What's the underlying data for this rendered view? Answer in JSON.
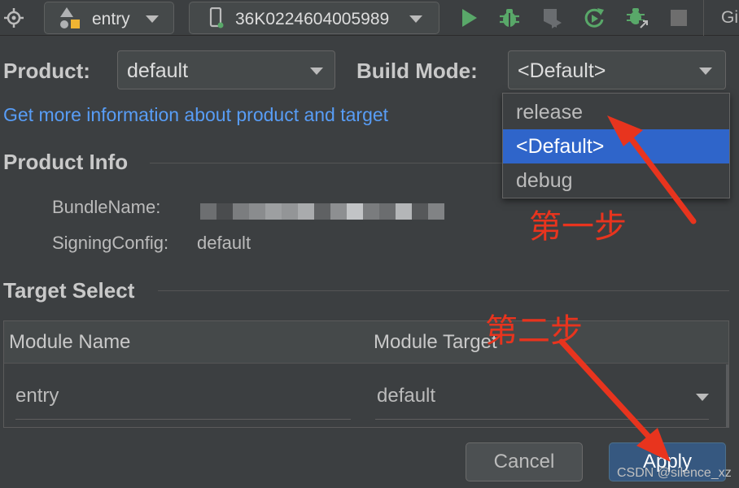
{
  "toolbar": {
    "module_combo": "entry",
    "device_combo": "36K0224604005989",
    "vcs_label": "Gi",
    "icons": [
      "target-icon",
      "module-shapes-icon",
      "device-phone-icon",
      "run-icon",
      "debug-bug-icon",
      "profiler-icon",
      "rerun-icon",
      "attach-debugger-icon",
      "stop-icon"
    ],
    "colors": {
      "run": "#59a869",
      "debug": "#59a869",
      "stop": "#6e6e6e"
    }
  },
  "form": {
    "product_label": "Product:",
    "product_value": "default",
    "build_mode_label": "Build Mode:",
    "build_mode_value": "<Default>",
    "info_link": "Get more information about product and target"
  },
  "product_info": {
    "title": "Product Info",
    "bundle_key": "BundleName:",
    "signing_key": "SigningConfig:",
    "signing_value": "default"
  },
  "target_select": {
    "title": "Target Select",
    "columns": [
      "Module Name",
      "Module Target"
    ],
    "rows": [
      {
        "module_name": "entry",
        "module_target": "default"
      }
    ]
  },
  "build_mode_dropdown": {
    "options": [
      "release",
      "<Default>",
      "debug"
    ],
    "selected": "<Default>"
  },
  "buttons": {
    "cancel": "Cancel",
    "apply": "Apply"
  },
  "annotations": {
    "step1": "第一步",
    "step2": "第二步",
    "color": "#e8341e"
  },
  "watermark": "CSDN @silence_xz",
  "colors": {
    "link": "#589df6",
    "selection": "#2f65ca",
    "apply": "#365880",
    "background": "#3c3f41"
  }
}
